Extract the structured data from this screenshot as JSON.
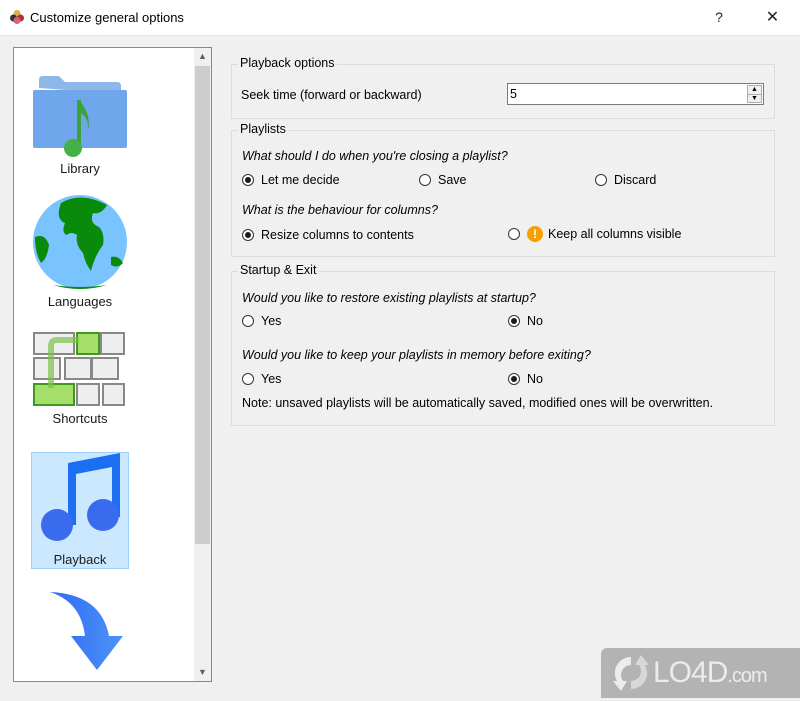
{
  "window": {
    "title": "Customize general options",
    "help_label": "?",
    "close_label": "✕"
  },
  "nav": {
    "items": [
      {
        "label": "Library",
        "icon": "folder-music-icon",
        "selected": false
      },
      {
        "label": "Languages",
        "icon": "globe-icon",
        "selected": false
      },
      {
        "label": "Shortcuts",
        "icon": "keyboard-icon",
        "selected": false
      },
      {
        "label": "Playback",
        "icon": "music-note-icon",
        "selected": true
      },
      {
        "label": "",
        "icon": "arrow-down-icon",
        "selected": false
      }
    ],
    "scroll_up": "▲",
    "scroll_down": "▼"
  },
  "playback_options": {
    "title": "Playback options",
    "seek_label": "Seek time (forward or backward)",
    "seek_value": "5"
  },
  "playlists": {
    "title": "Playlists",
    "closing_question": "What should I do when you're closing a playlist?",
    "closing_options": [
      {
        "label": "Let me decide",
        "checked": true
      },
      {
        "label": "Save",
        "checked": false
      },
      {
        "label": "Discard",
        "checked": false
      }
    ],
    "columns_question": "What is the behaviour for columns?",
    "columns_options": [
      {
        "label": "Resize columns to contents",
        "checked": true
      },
      {
        "label": "Keep all columns visible",
        "checked": false,
        "warning": true
      }
    ],
    "warning_glyph": "!"
  },
  "startup_exit": {
    "title": "Startup & Exit",
    "restore_question": "Would you like to restore existing playlists at startup?",
    "restore_options": [
      {
        "label": "Yes",
        "checked": false
      },
      {
        "label": "No",
        "checked": true
      }
    ],
    "memory_question": "Would you like to keep your playlists in memory before exiting?",
    "memory_options": [
      {
        "label": "Yes",
        "checked": false
      },
      {
        "label": "No",
        "checked": true
      }
    ],
    "note": "Note: unsaved playlists will be automatically saved, modified ones will be overwritten."
  },
  "watermark": {
    "text": "LO4D",
    "suffix": ".com"
  }
}
